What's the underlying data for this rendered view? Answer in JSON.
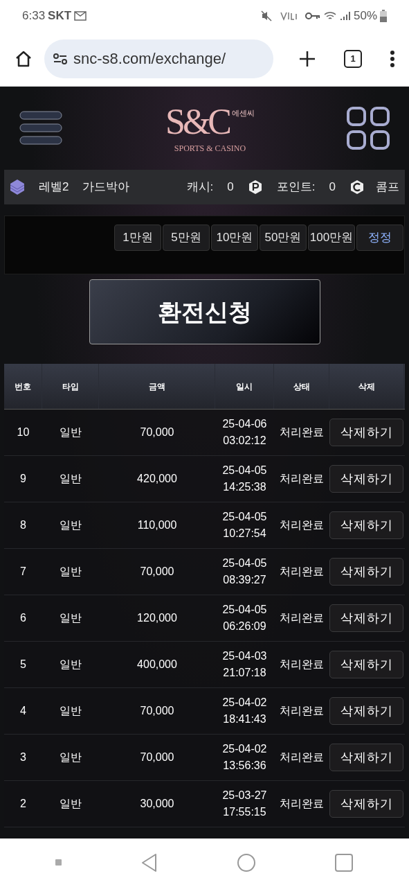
{
  "status_bar": {
    "time": "6:33",
    "carrier": "SKT",
    "battery": "50%"
  },
  "browser": {
    "url": "snc-s8.com/exchange/",
    "tab_count": "1"
  },
  "logo": {
    "monogram": "S&C",
    "korean": "에센씨",
    "tagline": "SPORTS & CASINO"
  },
  "user_bar": {
    "level": "레벨2",
    "nickname": "가드박아",
    "cash_label": "캐시:",
    "cash": "0",
    "point_label": "포인트:",
    "points": "0",
    "comp_label": "콤프"
  },
  "amount_buttons": [
    {
      "label": "1만원",
      "kind": "amount"
    },
    {
      "label": "5만원",
      "kind": "amount"
    },
    {
      "label": "10만원",
      "kind": "amount"
    },
    {
      "label": "50만원",
      "kind": "amount"
    },
    {
      "label": "100만원",
      "kind": "amount"
    },
    {
      "label": "정정",
      "kind": "reset"
    }
  ],
  "submit_button": "환전신청",
  "table": {
    "columns": [
      "번호",
      "타입",
      "금액",
      "일시",
      "상태",
      "삭제"
    ],
    "rows": [
      {
        "no": "10",
        "type": "일반",
        "amount": "70,000",
        "date": "25-04-06",
        "time": "03:02:12",
        "status": "처리완료",
        "action": "삭제하기"
      },
      {
        "no": "9",
        "type": "일반",
        "amount": "420,000",
        "date": "25-04-05",
        "time": "14:25:38",
        "status": "처리완료",
        "action": "삭제하기"
      },
      {
        "no": "8",
        "type": "일반",
        "amount": "110,000",
        "date": "25-04-05",
        "time": "10:27:54",
        "status": "처리완료",
        "action": "삭제하기"
      },
      {
        "no": "7",
        "type": "일반",
        "amount": "70,000",
        "date": "25-04-05",
        "time": "08:39:27",
        "status": "처리완료",
        "action": "삭제하기"
      },
      {
        "no": "6",
        "type": "일반",
        "amount": "120,000",
        "date": "25-04-05",
        "time": "06:26:09",
        "status": "처리완료",
        "action": "삭제하기"
      },
      {
        "no": "5",
        "type": "일반",
        "amount": "400,000",
        "date": "25-04-03",
        "time": "21:07:18",
        "status": "처리완료",
        "action": "삭제하기"
      },
      {
        "no": "4",
        "type": "일반",
        "amount": "70,000",
        "date": "25-04-02",
        "time": "18:41:43",
        "status": "처리완료",
        "action": "삭제하기"
      },
      {
        "no": "3",
        "type": "일반",
        "amount": "70,000",
        "date": "25-04-02",
        "time": "13:56:36",
        "status": "처리완료",
        "action": "삭제하기"
      },
      {
        "no": "2",
        "type": "일반",
        "amount": "30,000",
        "date": "25-03-27",
        "time": "17:55:15",
        "status": "처리완료",
        "action": "삭제하기"
      }
    ]
  }
}
